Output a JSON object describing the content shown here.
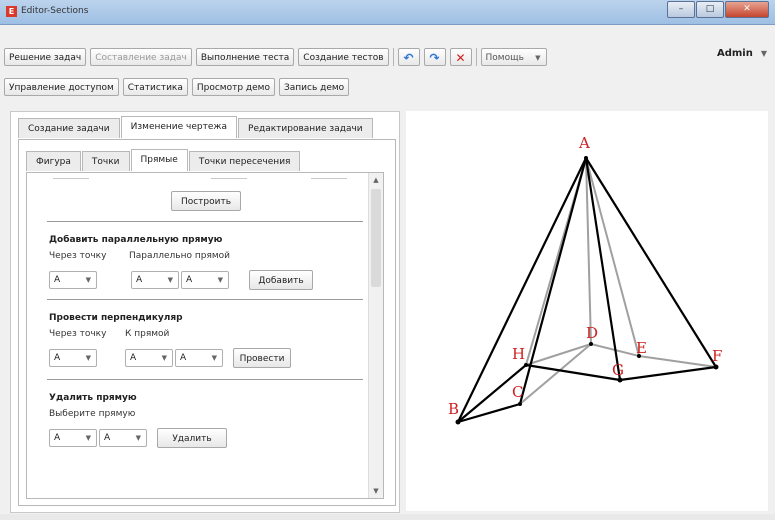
{
  "window": {
    "title": "Editor-Sections",
    "app_icon": "E",
    "minimize": "–",
    "maximize": "□",
    "close": "✕"
  },
  "toolbar1": {
    "solve": "Решение задач",
    "compose": "Составление задач",
    "run_test": "Выполнение теста",
    "create_tests": "Создание тестов",
    "help": "Помощь",
    "undo_icon": "↶",
    "redo_icon": "↷",
    "delete_icon": "✕"
  },
  "toolbar2": {
    "access": "Управление доступом",
    "stats": "Статистика",
    "view_demo": "Просмотр демо",
    "record_demo": "Запись демо"
  },
  "user": {
    "name": "Admin",
    "caret": "▼"
  },
  "tabs": {
    "create": "Создание задачи",
    "edit_drawing": "Изменение чертежа",
    "edit_task": "Редактирование задачи"
  },
  "subtabs": {
    "figure": "Фигура",
    "points": "Точки",
    "lines": "Прямые",
    "intersections": "Точки пересечения"
  },
  "panel": {
    "build": "Построить",
    "parallel": {
      "title": "Добавить параллельную прямую",
      "through": "Через точку",
      "parallel_to": "Параллельно прямой",
      "add": "Добавить",
      "v1": "A",
      "v2": "A",
      "v3": "A"
    },
    "perpendicular": {
      "title": "Провести перпендикуляр",
      "through": "Через точку",
      "to_line": "К прямой",
      "draw": "Провести",
      "v1": "A",
      "v2": "A",
      "v3": "A"
    },
    "remove": {
      "title": "Удалить прямую",
      "choose": "Выберите прямую",
      "delete": "Удалить",
      "v1": "A",
      "v2": "A"
    }
  },
  "figure": {
    "colors": {
      "edge": "#000000",
      "hidden": "#a0a0a0",
      "label": "#cc1f1f"
    },
    "labels": {
      "A": "A",
      "B": "B",
      "C": "C",
      "D": "D",
      "E": "E",
      "F": "F",
      "G": "G",
      "H": "H"
    }
  }
}
